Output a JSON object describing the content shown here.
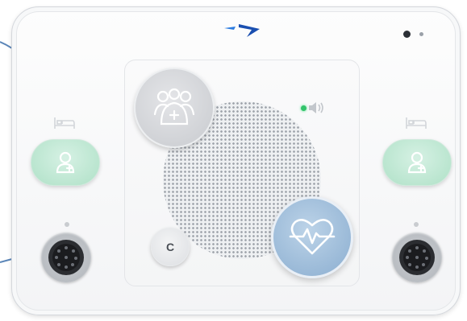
{
  "device": {
    "colors": {
      "accent": "#1f6fd1",
      "staff_button": "#cfd1d5",
      "heart_button": "#97b7d6",
      "patient_button": "#b7e4cd",
      "status_led": "#33c36b"
    },
    "icons": {
      "logo": "arrow-logo-icon",
      "camera": "camera-lens-icon",
      "sound_led": "status-led-icon",
      "sound": "speaker-volume-icon",
      "staff": "staff-group-icon",
      "heart": "heart-pulse-icon",
      "patient": "patient-call-icon",
      "bed": "bed-icon",
      "port": "connector-port-icon"
    },
    "cancel_button": {
      "label": "C"
    }
  }
}
